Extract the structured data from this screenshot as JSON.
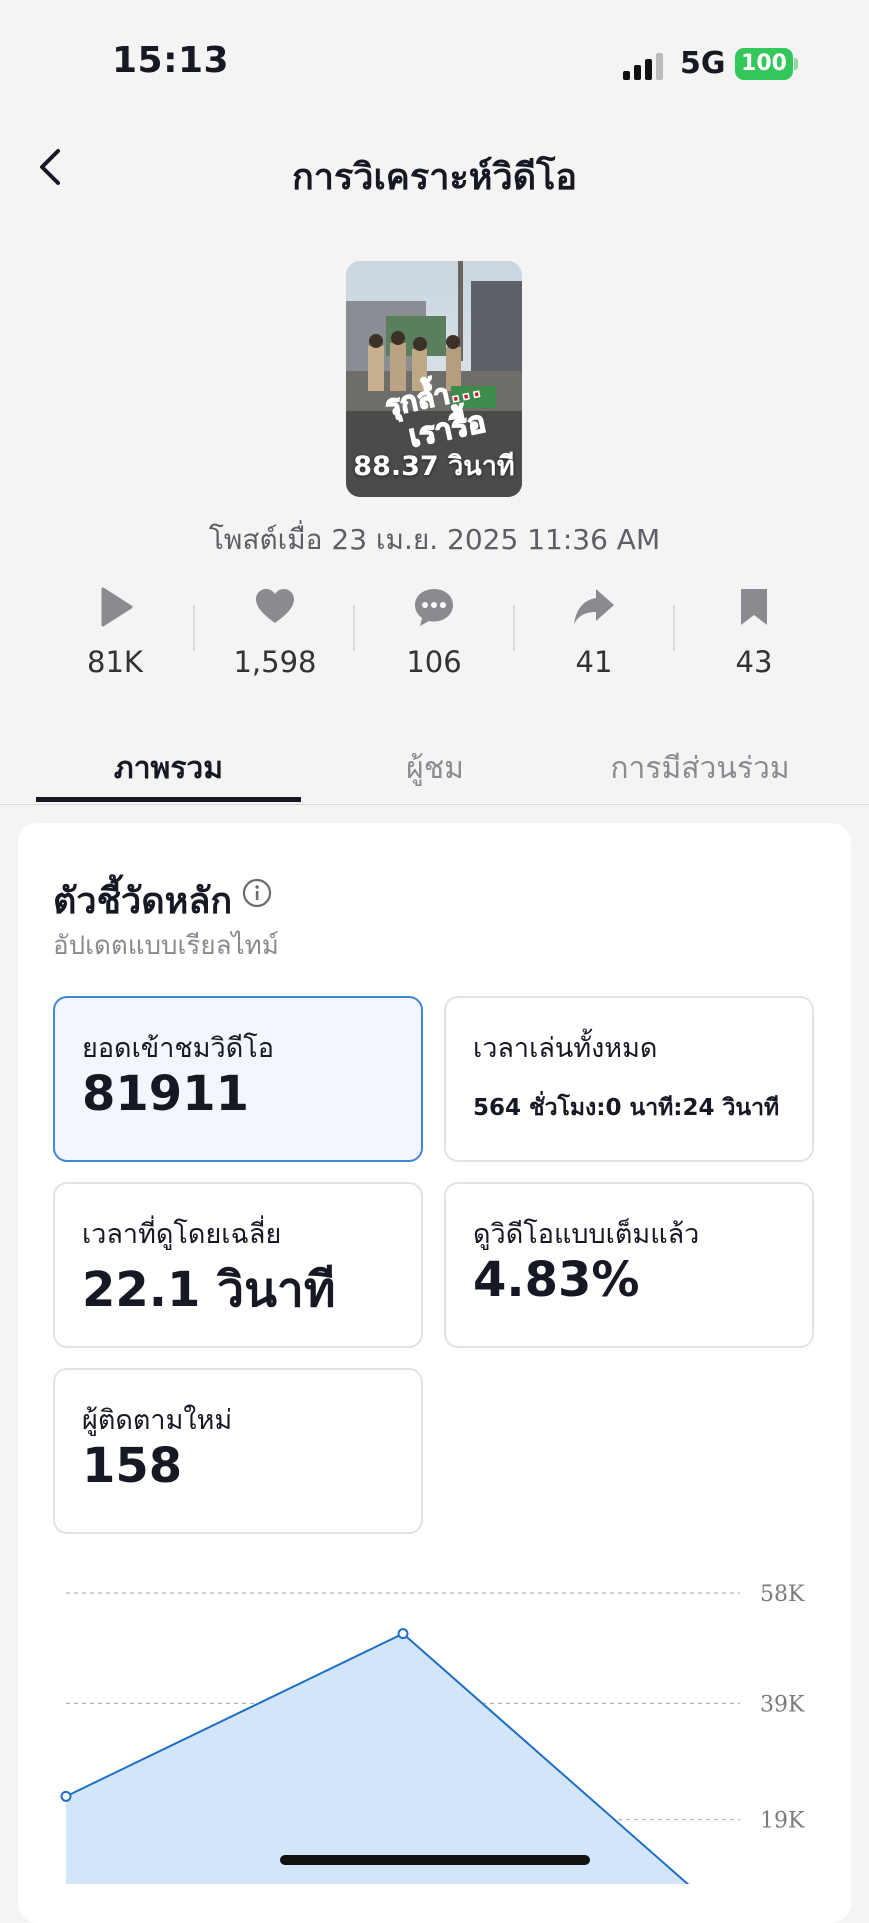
{
  "status_bar": {
    "time": "15:13",
    "network": "5G",
    "battery": "100"
  },
  "header": {
    "title": "การวิเคราะห์วิดีโอ"
  },
  "video": {
    "duration": "88.37 วินาที",
    "posted": "โพสต์เมื่อ 23 เม.ย. 2025 11:36 AM",
    "overlay_text": [
      "รุกล้ำ...",
      "เรารื้อ"
    ]
  },
  "stats": [
    {
      "icon": "play-icon",
      "value": "81K"
    },
    {
      "icon": "heart-icon",
      "value": "1,598"
    },
    {
      "icon": "comment-icon",
      "value": "106"
    },
    {
      "icon": "share-icon",
      "value": "41"
    },
    {
      "icon": "bookmark-icon",
      "value": "43"
    }
  ],
  "tabs": [
    {
      "label": "ภาพรวม",
      "active": true
    },
    {
      "label": "ผู้ชม",
      "active": false
    },
    {
      "label": "การมีส่วนร่วม",
      "active": false
    }
  ],
  "key_metrics": {
    "title": "ตัวชี้วัดหลัก",
    "subtitle": "อัปเดตแบบเรียลไทม์",
    "items": [
      {
        "label": "ยอดเข้าชมวิดีโอ",
        "value": "81911",
        "selected": true
      },
      {
        "label": "เวลาเล่นทั้งหมด",
        "value": "564 ชั่วโมง:0 นาที:24 วินาที",
        "selected": false
      },
      {
        "label": "เวลาที่ดูโดยเฉลี่ย",
        "value": "22.1 วินาที",
        "selected": false
      },
      {
        "label": "ดูวิดีโอแบบเต็มแล้ว",
        "value": "4.83%",
        "selected": false
      },
      {
        "label": "ผู้ติดตามใหม่",
        "value": "158",
        "selected": false
      }
    ]
  },
  "chart_data": {
    "type": "area",
    "x": [
      0,
      1,
      2
    ],
    "values": [
      23000,
      51000,
      0
    ],
    "y_ticks": [
      "58K",
      "39K",
      "19K"
    ],
    "y_tick_values": [
      58000,
      39000,
      19000
    ],
    "ylim": [
      0,
      58000
    ],
    "grid": true,
    "color": "#1f6fc5",
    "fill": "#d3e5f8"
  }
}
